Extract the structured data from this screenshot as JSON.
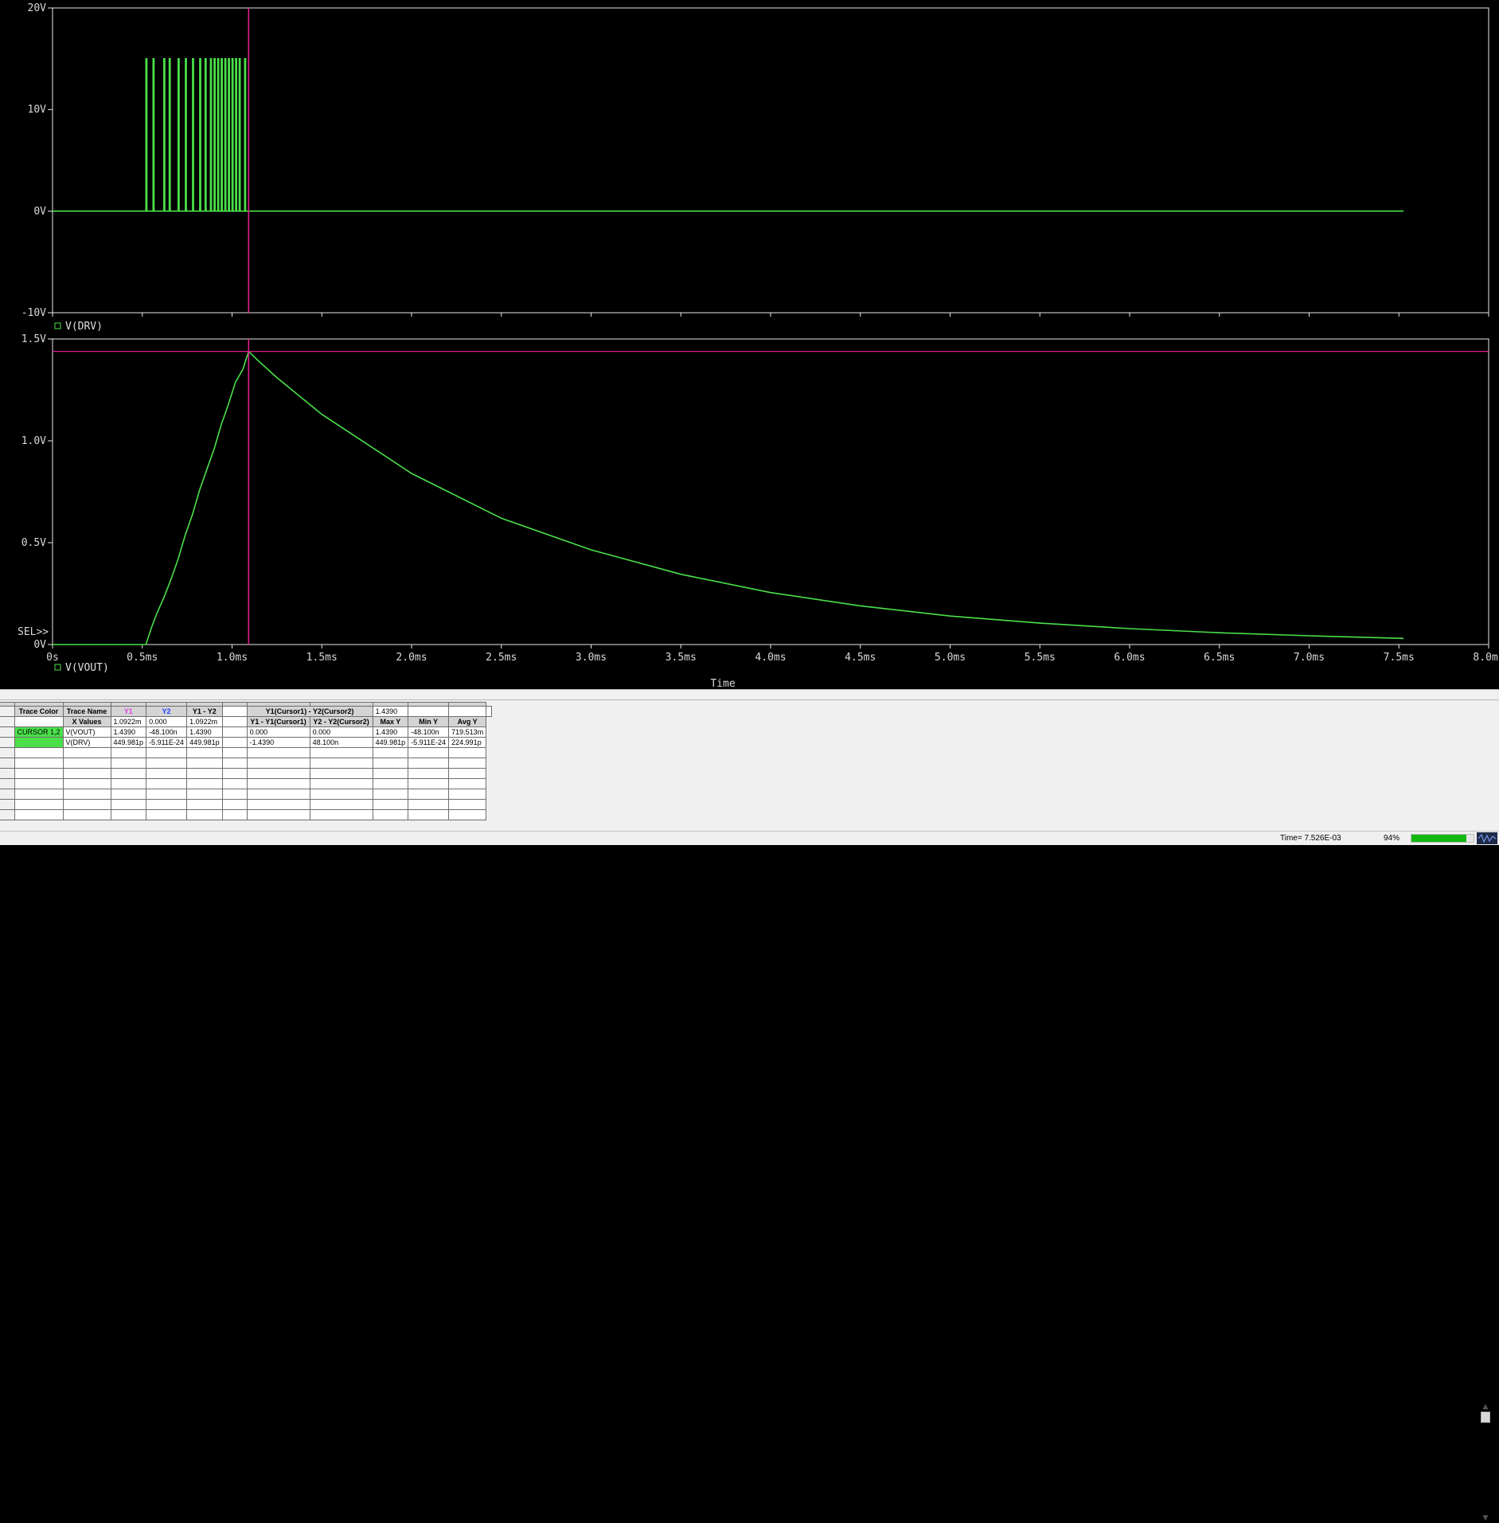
{
  "window": {
    "colors": {
      "plot_bg": "#000000",
      "trace": "#4ae04a",
      "cursor": "#e01e8c",
      "axis": "#e8e8e8"
    }
  },
  "chart_data": [
    {
      "type": "line",
      "title": "",
      "xlabel": "",
      "ylabel": "",
      "xlim": [
        0,
        8.0
      ],
      "ylim": [
        -10,
        20
      ],
      "x_ticks": [
        "0s",
        "0.5ms",
        "1.0ms",
        "1.5ms",
        "2.0ms",
        "2.5ms",
        "3.0ms",
        "3.5ms",
        "4.0ms",
        "4.5ms",
        "5.0ms",
        "5.5ms",
        "6.0ms",
        "6.5ms",
        "7.0ms",
        "7.5ms",
        "8.0ms"
      ],
      "x_ticks_shown": false,
      "y_ticks": [
        {
          "value": 20,
          "label": "20V"
        },
        {
          "value": 10,
          "label": "10V"
        },
        {
          "value": 0,
          "label": "0V"
        },
        {
          "value": -10,
          "label": "-10V"
        }
      ],
      "series": [
        {
          "name": "V(DRV)",
          "pulse_amplitude": 15,
          "pulse_times_ms": [
            0.52,
            0.56,
            0.62,
            0.65,
            0.7,
            0.74,
            0.78,
            0.82,
            0.85,
            0.88,
            0.9,
            0.92,
            0.94,
            0.96,
            0.98,
            1.0,
            1.02,
            1.04,
            1.07
          ],
          "end_ms": 7.526
        }
      ],
      "cursor_x_ms": 1.0922,
      "legend_placement": "bottom-left"
    },
    {
      "type": "line",
      "title": "",
      "xlabel": "Time",
      "ylabel": "",
      "xlim": [
        0,
        8.0
      ],
      "ylim": [
        0,
        1.5
      ],
      "x_ticks": [
        "0s",
        "0.5ms",
        "1.0ms",
        "1.5ms",
        "2.0ms",
        "2.5ms",
        "3.0ms",
        "3.5ms",
        "4.0ms",
        "4.5ms",
        "5.0ms",
        "5.5ms",
        "6.0ms",
        "6.5ms",
        "7.0ms",
        "7.5ms",
        "8.0ms"
      ],
      "y_ticks": [
        {
          "value": 1.5,
          "label": "1.5V"
        },
        {
          "value": 1.0,
          "label": "1.0V"
        },
        {
          "value": 0.5,
          "label": "0.5V"
        },
        {
          "value": 0.0,
          "label": "0V"
        }
      ],
      "series": [
        {
          "name": "V(VOUT)",
          "x": [
            0.0,
            0.52,
            0.55,
            0.58,
            0.62,
            0.66,
            0.7,
            0.74,
            0.78,
            0.82,
            0.86,
            0.9,
            0.94,
            0.98,
            1.02,
            1.06,
            1.0922,
            1.15,
            1.25,
            1.5,
            2.0,
            2.5,
            3.0,
            3.5,
            4.0,
            4.5,
            5.0,
            5.5,
            6.0,
            6.5,
            7.0,
            7.526
          ],
          "y": [
            0.0,
            0.0,
            0.08,
            0.15,
            0.23,
            0.32,
            0.42,
            0.54,
            0.64,
            0.76,
            0.86,
            0.96,
            1.08,
            1.18,
            1.29,
            1.35,
            1.439,
            1.39,
            1.31,
            1.13,
            0.84,
            0.62,
            0.465,
            0.345,
            0.255,
            0.19,
            0.14,
            0.105,
            0.078,
            0.058,
            0.043,
            0.03
          ]
        }
      ],
      "cursor_x_ms": 1.0922,
      "cursor_y_v": 1.439,
      "sel_label": "SEL>>",
      "legend_placement": "bottom-left"
    }
  ],
  "cursor_table": {
    "headers": {
      "trace_color": "Trace Color",
      "trace_name": "Trace Name",
      "y1": "Y1",
      "y2": "Y2",
      "y1_y2": "Y1 - Y2",
      "diff_cursors": "Y1(Cursor1) - Y2(Cursor2)",
      "diff_value": "1.4390",
      "x_values": "X Values",
      "y1_cursor1": "Y1 - Y1(Cursor1)",
      "y2_cursor2": "Y2 - Y2(Cursor2)",
      "max_y": "Max Y",
      "min_y": "Min Y",
      "avg_y": "Avg Y"
    },
    "x_row": {
      "y1": "1.0922m",
      "y2": "0.000",
      "y1_y2": "1.0922m"
    },
    "rows": [
      {
        "color_label": "CURSOR 1,2",
        "name": "V(VOUT)",
        "y1": "1.4390",
        "y2": "-48.100n",
        "y1_y2": "1.4390",
        "y1_c1": "0.000",
        "y2_c2": "0.000",
        "max_y": "1.4390",
        "min_y": "-48.100n",
        "avg_y": "719.513m"
      },
      {
        "color_label": "",
        "name": "V(DRV)",
        "y1": "449.981p",
        "y2": "-5.911E-24",
        "y1_y2": "449.981p",
        "y1_c1": "-1.4390",
        "y2_c2": "48.100n",
        "max_y": "449.981p",
        "min_y": "-5.911E-24",
        "avg_y": "224.991p"
      }
    ],
    "empty_rows": 7
  },
  "status_bar": {
    "time_text": "Time= 7.526E-03",
    "zoom_text": "94%",
    "progress": 0.88
  },
  "icons": {
    "scroll_up": "▲",
    "scroll_down": "▼",
    "wave": "waveform-icon"
  }
}
